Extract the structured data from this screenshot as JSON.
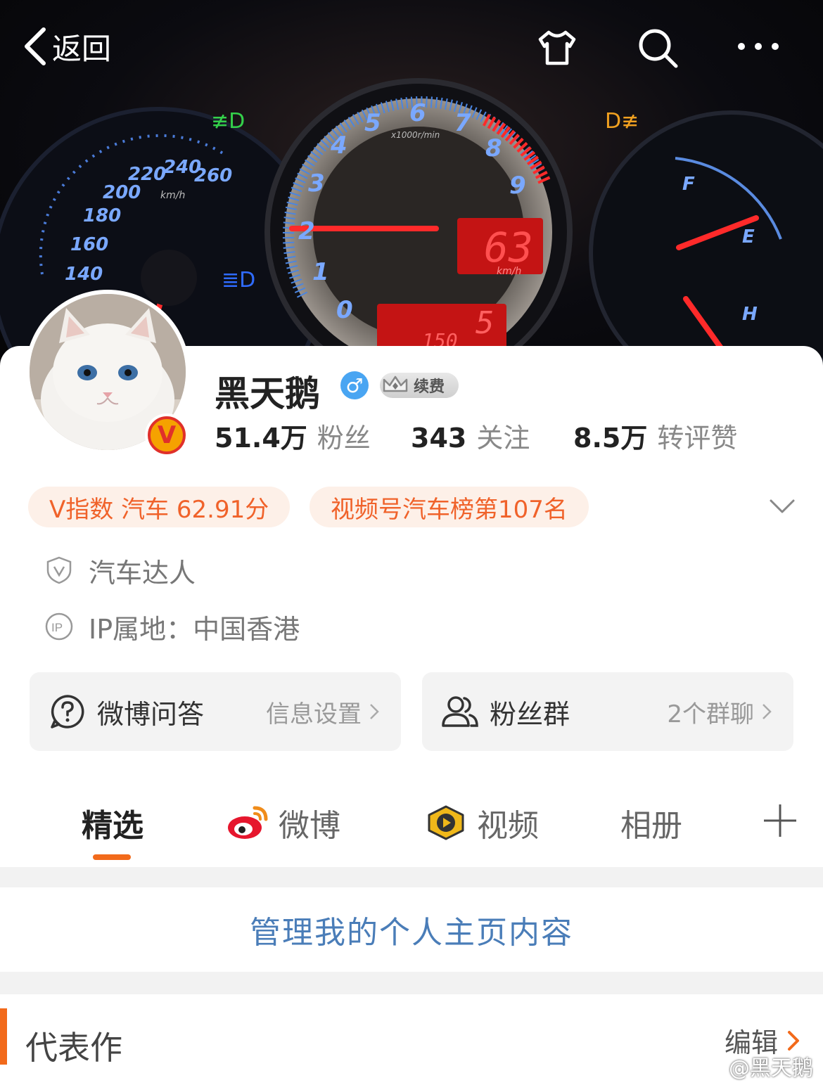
{
  "nav": {
    "back_label": "返回"
  },
  "cover": {
    "speed_readout": "63",
    "speed_unit": "km/h",
    "gear": "5",
    "odo": "150",
    "rpm_unit": "x1000r/min",
    "speedo_ticks": [
      "140",
      "160",
      "180",
      "200",
      "220",
      "240",
      "260"
    ],
    "speedo_unit": "km/h",
    "tach_ticks": [
      "0",
      "1",
      "2",
      "3",
      "4",
      "5",
      "6",
      "7",
      "8",
      "9"
    ],
    "fuel_f": "F",
    "fuel_e": "E",
    "temp_h": "H"
  },
  "profile": {
    "name": "黑天鹅",
    "gender_symbol": "♂",
    "renew_label": "续费",
    "verified_letter": "V",
    "stats": [
      {
        "num": "51.4万",
        "label": "粉丝"
      },
      {
        "num": "343",
        "label": "关注"
      },
      {
        "num": "8.5万",
        "label": "转评赞"
      }
    ],
    "badges": [
      "V指数 汽车 62.91分",
      "视频号汽车榜第107名"
    ],
    "verified_title": "汽车达人",
    "ip_location": "IP属地：中国香港"
  },
  "tiles": [
    {
      "title": "微博问答",
      "sub": "信息设置"
    },
    {
      "title": "粉丝群",
      "sub": "2个群聊"
    }
  ],
  "tabs": [
    {
      "label": "精选",
      "active": true
    },
    {
      "label": "微博",
      "active": false
    },
    {
      "label": "视频",
      "active": false
    },
    {
      "label": "相册",
      "active": false
    }
  ],
  "manage_label": "管理我的个人主页内容",
  "works": {
    "title": "代表作",
    "edit_label": "编辑"
  },
  "watermark": "@黑天鹅",
  "colors": {
    "accent": "#f26a1b",
    "link": "#4a7db8",
    "badge_bg": "#fdf0e8",
    "badge_text": "#f0622a"
  }
}
